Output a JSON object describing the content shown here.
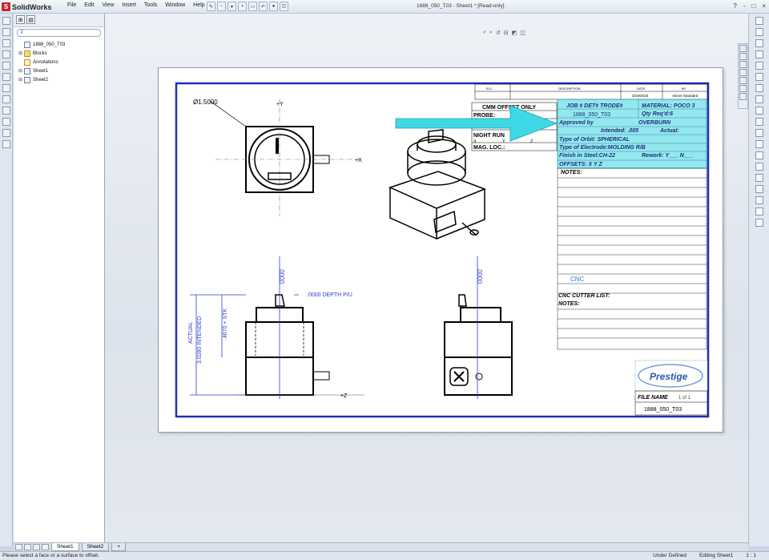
{
  "app": {
    "name": "SolidWorks",
    "doc_title": "1888_050_T03 - Sheet1 * [Read-only]",
    "menu": [
      "File",
      "Edit",
      "View",
      "Insert",
      "Tools",
      "Window",
      "Help"
    ],
    "win_controls": [
      "?",
      "-",
      "□",
      "×"
    ]
  },
  "tree": {
    "root": "1888_050_T03",
    "items": [
      "Blocks",
      "Annotations",
      "Sheet1",
      "Sheet2"
    ]
  },
  "sheet_tabs": [
    "Sheet1",
    "Sheet2"
  ],
  "status": {
    "message": "Please select a face or a surface to offset.",
    "state": "Under Defined",
    "editing": "Editing Sheet1",
    "scale": "1 : 1"
  },
  "drawing": {
    "dim_diameter": "Ø1.5000",
    "axis_y": "+Y",
    "axis_x": "+X",
    "axis_z": "+Z",
    "dim_zero_1": ".0000",
    "dim_zero_2": ".0000",
    "depth_note": ".0000 DEPTH P/U",
    "dim_height": ".4670 + STK",
    "actual_label": "ACTUAL",
    "intended_label": "3.0280 INTENDED",
    "title_block": {
      "rev_headers": [
        "ECL",
        "DESCRIPTION",
        "DATE",
        "BY"
      ],
      "rev_date": "3/19/2018",
      "rev_by": "Above Standard",
      "cmm_header": "CMM OFFSET ONLY",
      "probe": "PROBE:",
      "night_run": "NIGHT RUN",
      "xyz": [
        "X",
        "Y",
        "Z"
      ],
      "mag_loc": "MAG. LOC.:",
      "job": "JOB #  DET#  TRODE#",
      "job_no": "1888_050_T03",
      "material": "MATERIAL: POCO 3",
      "qty": "Qty Req'd:6",
      "approved_by": "Approved by",
      "overburn": "OVERBURN",
      "intended": "Intended: .005",
      "actual": "Actual:",
      "orbit": "Type of Orbit:  SPHERICAL",
      "electrode": "Type of Electrode:MOLDING R/B",
      "finish": "Finish in Steel:CH-22",
      "rework": "Rework:  Y___  N___",
      "offsets": "OFFSETS:  X          Y          Z",
      "notes": "NOTES:",
      "cnc": "CNC",
      "cnc_cutter": "CNC CUTTER LIST:",
      "notes2": "NOTES:",
      "logo_text": "Prestige",
      "file_name": "FILE NAME",
      "file_of": "1 of 1",
      "file_value": "1888_050_T03"
    }
  },
  "colors": {
    "border": "#1f2fb5",
    "dim_blue": "#2a3ec8",
    "highlight": "#6fe0ea",
    "arrow": "#3fd8e6"
  }
}
